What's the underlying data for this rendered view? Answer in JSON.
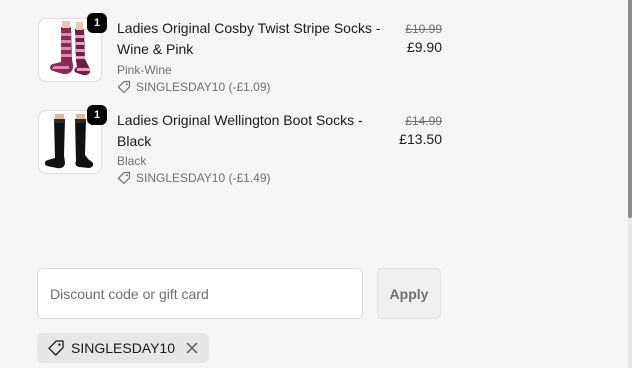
{
  "cart": {
    "items": [
      {
        "quantity": "1",
        "title": "Ladies Original Cosby Twist Stripe Socks - Wine & Pink",
        "variant": "Pink-Wine",
        "discount": "SINGLESDAY10 (-£1.09)",
        "original_price": "£10.99",
        "price": "£9.90",
        "image_icon": "pink-wine-striped-socks-image"
      },
      {
        "quantity": "1",
        "title": "Ladies Original Wellington Boot Socks - Black",
        "variant": "Black",
        "discount": "SINGLESDAY10 (-£1.49)",
        "original_price": "£14.99",
        "price": "£13.50",
        "image_icon": "black-boot-socks-image"
      }
    ]
  },
  "discount_form": {
    "placeholder": "Discount code or gift card",
    "value": "",
    "apply_label": "Apply"
  },
  "applied_codes": [
    {
      "code": "SINGLESDAY10",
      "icon": "tag-icon",
      "remove_icon": "close-icon"
    }
  ],
  "colors": {
    "background": "#f5f5f5",
    "badge": "#000000",
    "muted_text": "#707070",
    "chip_bg": "#e6e6e6"
  }
}
